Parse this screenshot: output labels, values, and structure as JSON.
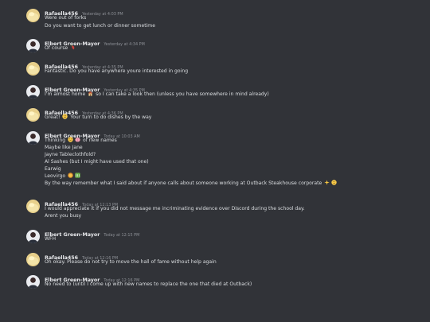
{
  "colors": {
    "background": "#313338",
    "username": "#e6e7ea",
    "timestamp": "#8d9096",
    "text": "#dbdee1"
  },
  "messages": [
    {
      "user": "Rafaella456",
      "time": "Yesterday at 4:03 PM",
      "avatar": "duck",
      "lines": [
        "Were out of forks",
        "Do you want to get lunch or dinner sometime"
      ]
    },
    {
      "user": "Elbert Green-Mayor",
      "time": "Yesterday at 4:34 PM",
      "avatar": "person",
      "lines": [
        "Of course"
      ]
    },
    {
      "user": "Rafaella456",
      "time": "Yesterday at 4:35 PM",
      "avatar": "duck",
      "lines": [
        "Fantastic. Do you have anywhere youre interested in going"
      ]
    },
    {
      "user": "Elbert Green-Mayor",
      "time": "Yesterday at 4:35 PM",
      "avatar": "person",
      "lines": [
        "I'm almost home",
        "so I can take a look then (unless you have somewhere in mind already)"
      ]
    },
    {
      "user": "Rafaella456",
      "time": "Yesterday at 4:36 PM",
      "avatar": "duck",
      "lines": [
        "Great!",
        "Your turn to do dishes by the way"
      ]
    },
    {
      "user": "Elbert Green-Mayor",
      "time": "Today at 10:03 AM",
      "avatar": "person",
      "lines": [
        "Thinking",
        "of new names",
        "Maybe like Jane",
        "Jayne Tableclothfold?",
        "Al Sashes (but I might have used that one)",
        "Earwig",
        "Leovirgo",
        "By the way remember what I said about if anyone calls about someone working at Outback Steakhouse corporate"
      ]
    },
    {
      "user": "Rafaella456",
      "time": "Today at 12:13 PM",
      "avatar": "duck",
      "lines": [
        "I would appreciate it if you did not message me incriminating evidence over Discord during the school day.",
        "Arent you busy"
      ]
    },
    {
      "user": "Elbert Green-Mayor",
      "time": "Today at 12:15 PM",
      "avatar": "person",
      "lines": [
        "WFH"
      ]
    },
    {
      "user": "Rafaella456",
      "time": "Today at 12:16 PM",
      "avatar": "duck",
      "lines": [
        "Oh okay. Please do not try to move the hall of fame without help again"
      ]
    },
    {
      "user": "Elbert Green-Mayor",
      "time": "Today at 12:16 PM",
      "avatar": "person",
      "lines": [
        "No need to (until I come up with new names to replace the one that died at Outback)"
      ]
    }
  ]
}
